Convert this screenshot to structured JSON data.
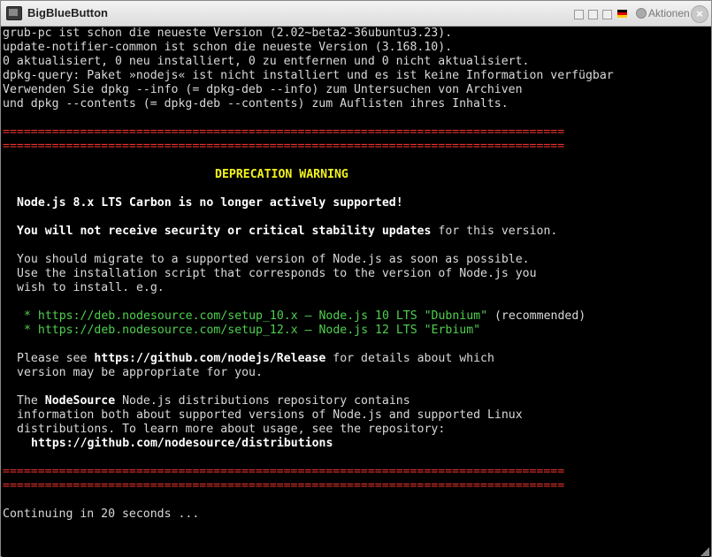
{
  "window": {
    "title": "BigBlueButton",
    "actions_label": "Aktionen",
    "close_glyph": "×"
  },
  "terminal": {
    "apt_lines": [
      "grub-pc ist schon die neueste Version (2.02~beta2-36ubuntu3.23).",
      "update-notifier-common ist schon die neueste Version (3.168.10).",
      "0 aktualisiert, 0 neu installiert, 0 zu entfernen und 0 nicht aktualisiert.",
      "dpkg-query: Paket »nodejs« ist nicht installiert und es ist keine Information verfügbar",
      "Verwenden Sie dpkg --info (= dpkg-deb --info) zum Untersuchen von Archiven",
      "und dpkg --contents (= dpkg-deb --contents) zum Auflisten ihres Inhalts."
    ],
    "separator": "================================================================================",
    "warning_title": "DEPRECATION WARNING",
    "not_supported": "Node.js 8.x LTS Carbon is no longer actively supported!",
    "no_updates_strong": "You will not receive security or critical stability updates",
    "no_updates_rest": " for this version.",
    "migrate_lines": [
      "You should migrate to a supported version of Node.js as soon as possible.",
      "Use the installation script that corresponds to the version of Node.js you",
      "wish to install. e.g."
    ],
    "bullet": "*",
    "option1": "https://deb.nodesource.com/setup_10.x — Node.js 10 LTS \"Dubnium\"",
    "option1_note": " (recommended)",
    "option2": "https://deb.nodesource.com/setup_12.x — Node.js 12 LTS \"Erbium\"",
    "see_prefix": "Please see ",
    "see_link": "https://github.com/nodejs/Release",
    "see_suffix": " for details about which",
    "see_line2": "version may be appropriate for you.",
    "repo_prefix": "The ",
    "repo_name": "NodeSource",
    "repo_suffix": " Node.js distributions repository contains",
    "repo_lines": [
      "information both about supported versions of Node.js and supported Linux",
      "distributions. To learn more about usage, see the repository:"
    ],
    "repo_link": "https://github.com/nodesource/distributions",
    "continuing": "Continuing in 20 seconds ..."
  },
  "colors": {
    "separator": "#e8322e",
    "warning": "#f2f21e",
    "link": "#4fd04f",
    "background": "#000000",
    "text": "#d9d9d9"
  }
}
